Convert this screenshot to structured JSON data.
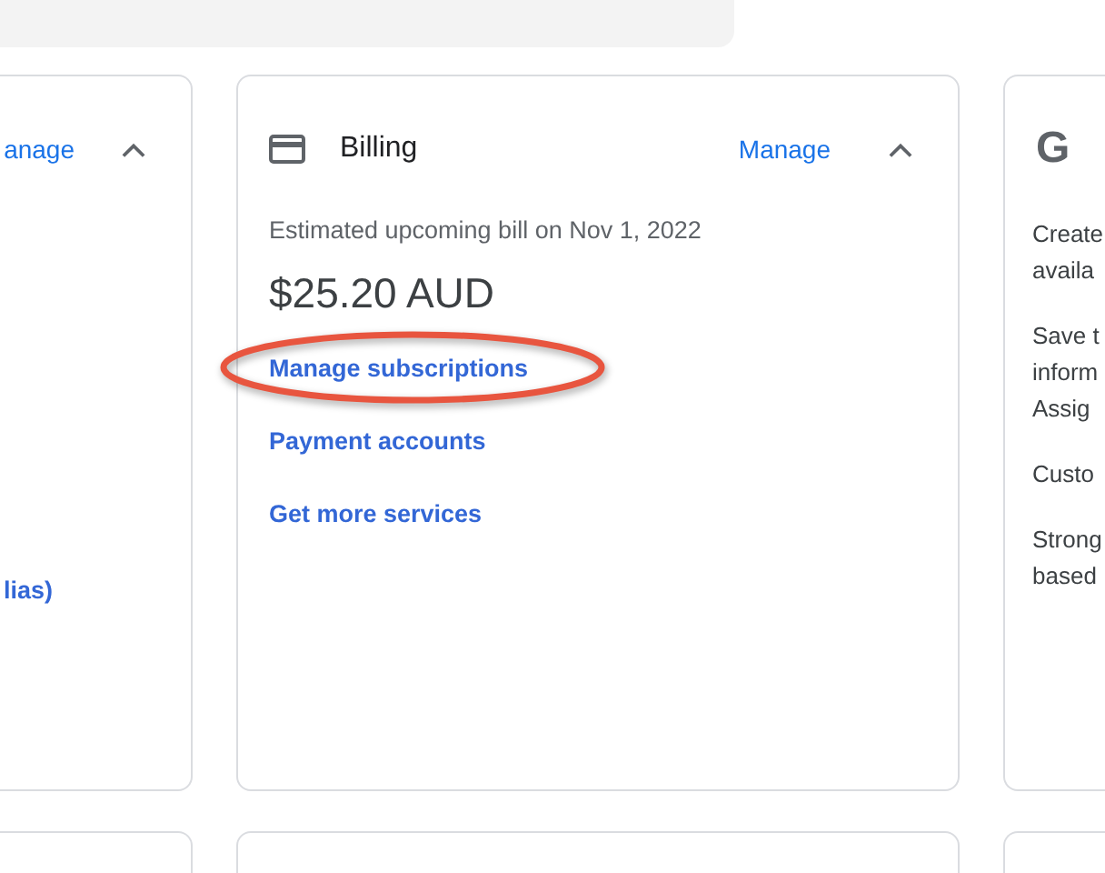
{
  "cards": [
    {
      "kind": "partial",
      "header_link": "anage",
      "expanded": true,
      "links": [
        {
          "text": "lias)"
        }
      ]
    },
    {
      "kind": "billing",
      "title": "Billing",
      "header_link": "Manage",
      "expanded": true,
      "caption": "Estimated upcoming bill on Nov 1, 2022",
      "amount": "$25.20 AUD",
      "links": [
        {
          "text": "Manage subscriptions",
          "highlighted": true
        },
        {
          "text": "Payment accounts",
          "highlighted": false
        },
        {
          "text": "Get more services",
          "highlighted": false
        }
      ]
    },
    {
      "kind": "logo",
      "logo": "G",
      "paragraphs": [
        [
          "Create",
          "availa"
        ],
        [
          "Save t",
          "inform",
          "Assig"
        ],
        [
          "Custo"
        ],
        [
          "Strong",
          "based"
        ]
      ]
    }
  ]
}
